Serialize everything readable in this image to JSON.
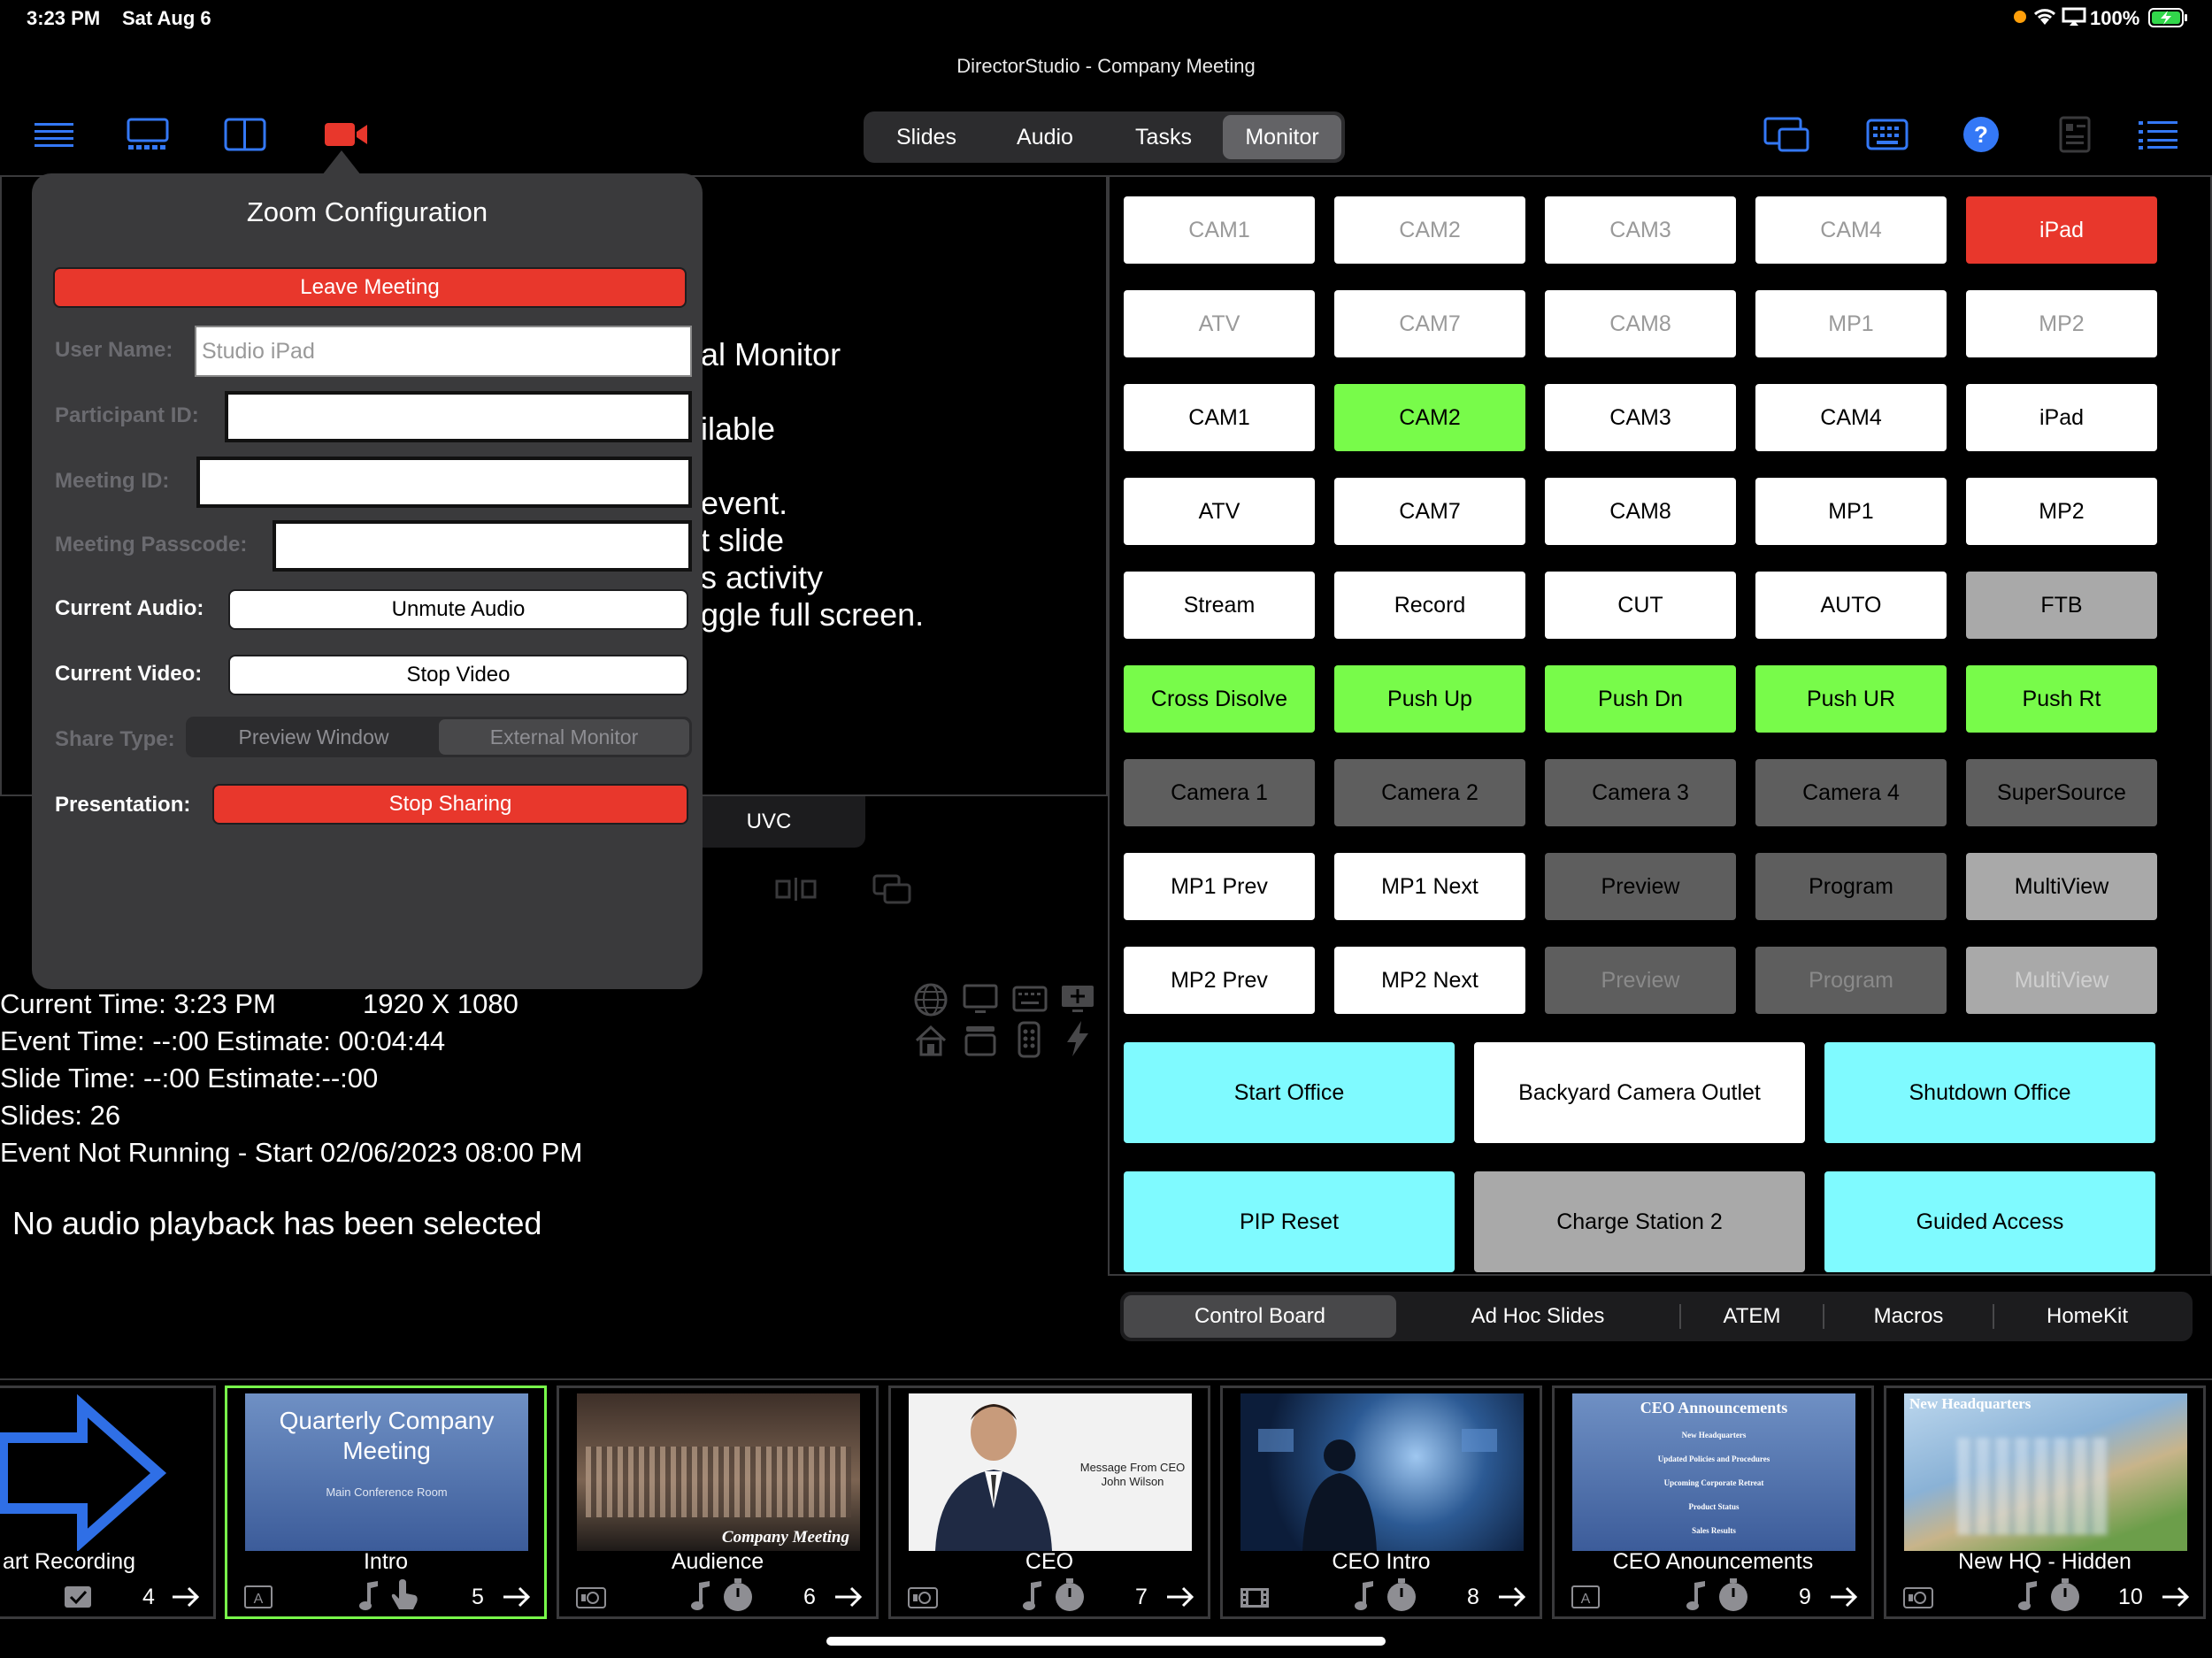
{
  "status_bar": {
    "time": "3:23 PM",
    "date": "Sat Aug 6",
    "battery": "100%"
  },
  "window_title": "DirectorStudio - Company Meeting",
  "top_tabs": [
    {
      "label": "Slides",
      "active": false
    },
    {
      "label": "Audio",
      "active": false
    },
    {
      "label": "Tasks",
      "active": false
    },
    {
      "label": "Monitor",
      "active": true
    }
  ],
  "toolbar_icons": {
    "left": [
      "menu-icon",
      "slides-grid-icon",
      "split-view-icon",
      "video-camera-icon"
    ],
    "right": [
      "screen-mirror-icon",
      "keyboard-icon",
      "help-icon",
      "slide-info-icon",
      "list-icon"
    ]
  },
  "background_text": [
    "al Monitor",
    "ilable",
    "event.",
    "t slide",
    "s activity",
    "ggle full screen."
  ],
  "uvc_label": "UVC",
  "info": {
    "current_time": "Current Time: 3:23 PM",
    "resolution": "1920 X 1080",
    "event_time": "Event Time: --:00  Estimate: 00:04:44",
    "slide_time": "Slide Time: --:00  Estimate:--:00",
    "slides": "Slides: 26",
    "event_status": "Event Not Running - Start 02/06/2023 08:00 PM",
    "audio_status": "No audio playback has been selected"
  },
  "zoom": {
    "title": "Zoom Configuration",
    "leave_meeting": "Leave Meeting",
    "user_name_label": "User Name:",
    "user_name_value": "Studio iPad",
    "participant_id_label": "Participant ID:",
    "meeting_id_label": "Meeting ID:",
    "meeting_passcode_label": "Meeting Passcode:",
    "current_audio_label": "Current Audio:",
    "current_audio_button": "Unmute Audio",
    "current_video_label": "Current Video:",
    "current_video_button": "Stop Video",
    "share_type_label": "Share Type:",
    "share_options": [
      "Preview Window",
      "External Monitor"
    ],
    "share_selected": "External Monitor",
    "presentation_label": "Presentation:",
    "presentation_button": "Stop Sharing"
  },
  "grid": [
    [
      {
        "label": "CAM1",
        "style": "c-white-dim"
      },
      {
        "label": "CAM2",
        "style": "c-white-dim"
      },
      {
        "label": "CAM3",
        "style": "c-white-dim"
      },
      {
        "label": "CAM4",
        "style": "c-white-dim"
      },
      {
        "label": "iPad",
        "style": "c-red"
      }
    ],
    [
      {
        "label": "ATV",
        "style": "c-white-dim"
      },
      {
        "label": "CAM7",
        "style": "c-white-dim"
      },
      {
        "label": "CAM8",
        "style": "c-white-dim"
      },
      {
        "label": "MP1",
        "style": "c-white-dim"
      },
      {
        "label": "MP2",
        "style": "c-white-dim"
      }
    ],
    [
      {
        "label": "CAM1",
        "style": "c-white"
      },
      {
        "label": "CAM2",
        "style": "c-green"
      },
      {
        "label": "CAM3",
        "style": "c-white"
      },
      {
        "label": "CAM4",
        "style": "c-white"
      },
      {
        "label": "iPad",
        "style": "c-white"
      }
    ],
    [
      {
        "label": "ATV",
        "style": "c-white"
      },
      {
        "label": "CAM7",
        "style": "c-white"
      },
      {
        "label": "CAM8",
        "style": "c-white"
      },
      {
        "label": "MP1",
        "style": "c-white"
      },
      {
        "label": "MP2",
        "style": "c-white"
      }
    ],
    [
      {
        "label": "Stream",
        "style": "c-white"
      },
      {
        "label": "Record",
        "style": "c-white"
      },
      {
        "label": "CUT",
        "style": "c-white"
      },
      {
        "label": "AUTO",
        "style": "c-white"
      },
      {
        "label": "FTB",
        "style": "c-gray"
      }
    ],
    [
      {
        "label": "Cross Disolve",
        "style": "c-green"
      },
      {
        "label": "Push Up",
        "style": "c-green"
      },
      {
        "label": "Push Dn",
        "style": "c-green"
      },
      {
        "label": "Push UR",
        "style": "c-green"
      },
      {
        "label": "Push Rt",
        "style": "c-green"
      }
    ],
    [
      {
        "label": "Camera 1",
        "style": "c-dark"
      },
      {
        "label": "Camera 2",
        "style": "c-dark"
      },
      {
        "label": "Camera 3",
        "style": "c-dark"
      },
      {
        "label": "Camera 4",
        "style": "c-dark"
      },
      {
        "label": "SuperSource",
        "style": "c-dark"
      }
    ],
    [
      {
        "label": "MP1 Prev",
        "style": "c-white"
      },
      {
        "label": "MP1 Next",
        "style": "c-white"
      },
      {
        "label": "Preview",
        "style": "c-dark"
      },
      {
        "label": "Program",
        "style": "c-dark"
      },
      {
        "label": "MultiView",
        "style": "c-light"
      }
    ],
    [
      {
        "label": "MP2 Prev",
        "style": "c-white"
      },
      {
        "label": "MP2 Next",
        "style": "c-white"
      },
      {
        "label": "Preview",
        "style": "c-dark-dim"
      },
      {
        "label": "Program",
        "style": "c-dark-dim"
      },
      {
        "label": "MultiView",
        "style": "c-light-dim"
      }
    ]
  ],
  "wide_buttons": [
    [
      {
        "label": "Start Office",
        "style": "c-cyan"
      },
      {
        "label": "Backyard Camera Outlet",
        "style": "c-white"
      },
      {
        "label": "Shutdown Office",
        "style": "c-cyan"
      }
    ],
    [
      {
        "label": "PIP Reset",
        "style": "c-cyan"
      },
      {
        "label": "Charge Station 2",
        "style": "c-gray"
      },
      {
        "label": "Guided Access",
        "style": "c-cyan"
      }
    ]
  ],
  "bottom_tabs": [
    {
      "label": "Control Board",
      "active": true
    },
    {
      "label": "Ad Hoc Slides",
      "active": false
    },
    {
      "label": "ATEM",
      "active": false
    },
    {
      "label": "Macros",
      "active": false
    },
    {
      "label": "HomeKit",
      "active": false
    }
  ],
  "slides": [
    {
      "name": "art Recording",
      "number": "4",
      "thumb": "arrow",
      "selected": false
    },
    {
      "name": "Intro",
      "number": "5",
      "thumb": "quarterly",
      "selected": true,
      "thumb_title": "Quarterly Company Meeting",
      "thumb_sub": "Main Conference Room"
    },
    {
      "name": "Audience",
      "number": "6",
      "thumb": "audience",
      "selected": false,
      "thumb_caption": "Company Meeting"
    },
    {
      "name": "CEO",
      "number": "7",
      "thumb": "ceo",
      "selected": false,
      "thumb_caption": "Message From CEO John Wilson"
    },
    {
      "name": "CEO Intro",
      "number": "8",
      "thumb": "stage",
      "selected": false
    },
    {
      "name": "CEO Anouncements",
      "number": "9",
      "thumb": "announce",
      "selected": false,
      "thumb_title": "CEO Announcements",
      "thumb_lines": [
        "New Headquarters",
        "Updated Policies and Procedures",
        "Upcoming Corporate Retreat",
        "Product Status",
        "Sales Results"
      ]
    },
    {
      "name": "New HQ - Hidden",
      "number": "10",
      "thumb": "hq",
      "selected": false,
      "thumb_title": "New Headquarters"
    }
  ],
  "colors": {
    "accent_blue": "#3478f6",
    "red": "#e8372c",
    "green": "#78fb4a",
    "cyan": "#7ffaff"
  }
}
